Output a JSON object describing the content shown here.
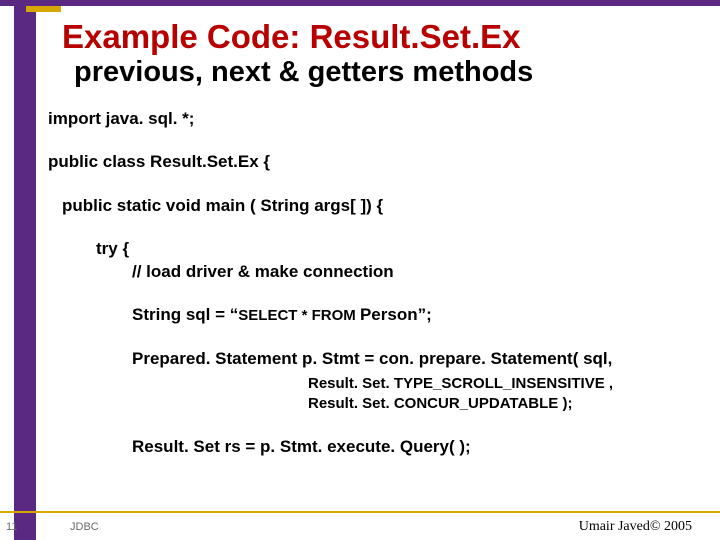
{
  "header": {
    "title": "Example Code: Result.Set.Ex",
    "subtitle": "previous, next & getters methods"
  },
  "code": {
    "l1": "import java. sql. *;",
    "l2": "public class Result.Set.Ex {",
    "l3": "public static void main ( String args[ ]) {",
    "l4": "try {",
    "l5": "// load driver & make connection",
    "l6a": "String sql = “",
    "l6b": "SELECT * FROM ",
    "l6c": "Person”;",
    "l7": "Prepared. Statement p. Stmt = con. prepare. Statement( sql,",
    "l8": "Result. Set. TYPE_SCROLL_INSENSITIVE ,",
    "l9": "Result. Set. CONCUR_UPDATABLE );",
    "l10": "Result. Set rs = p. Stmt. execute. Query( );"
  },
  "footer": {
    "slide_number": "11",
    "center": "JDBC",
    "right": "Umair Javed© 2005"
  }
}
